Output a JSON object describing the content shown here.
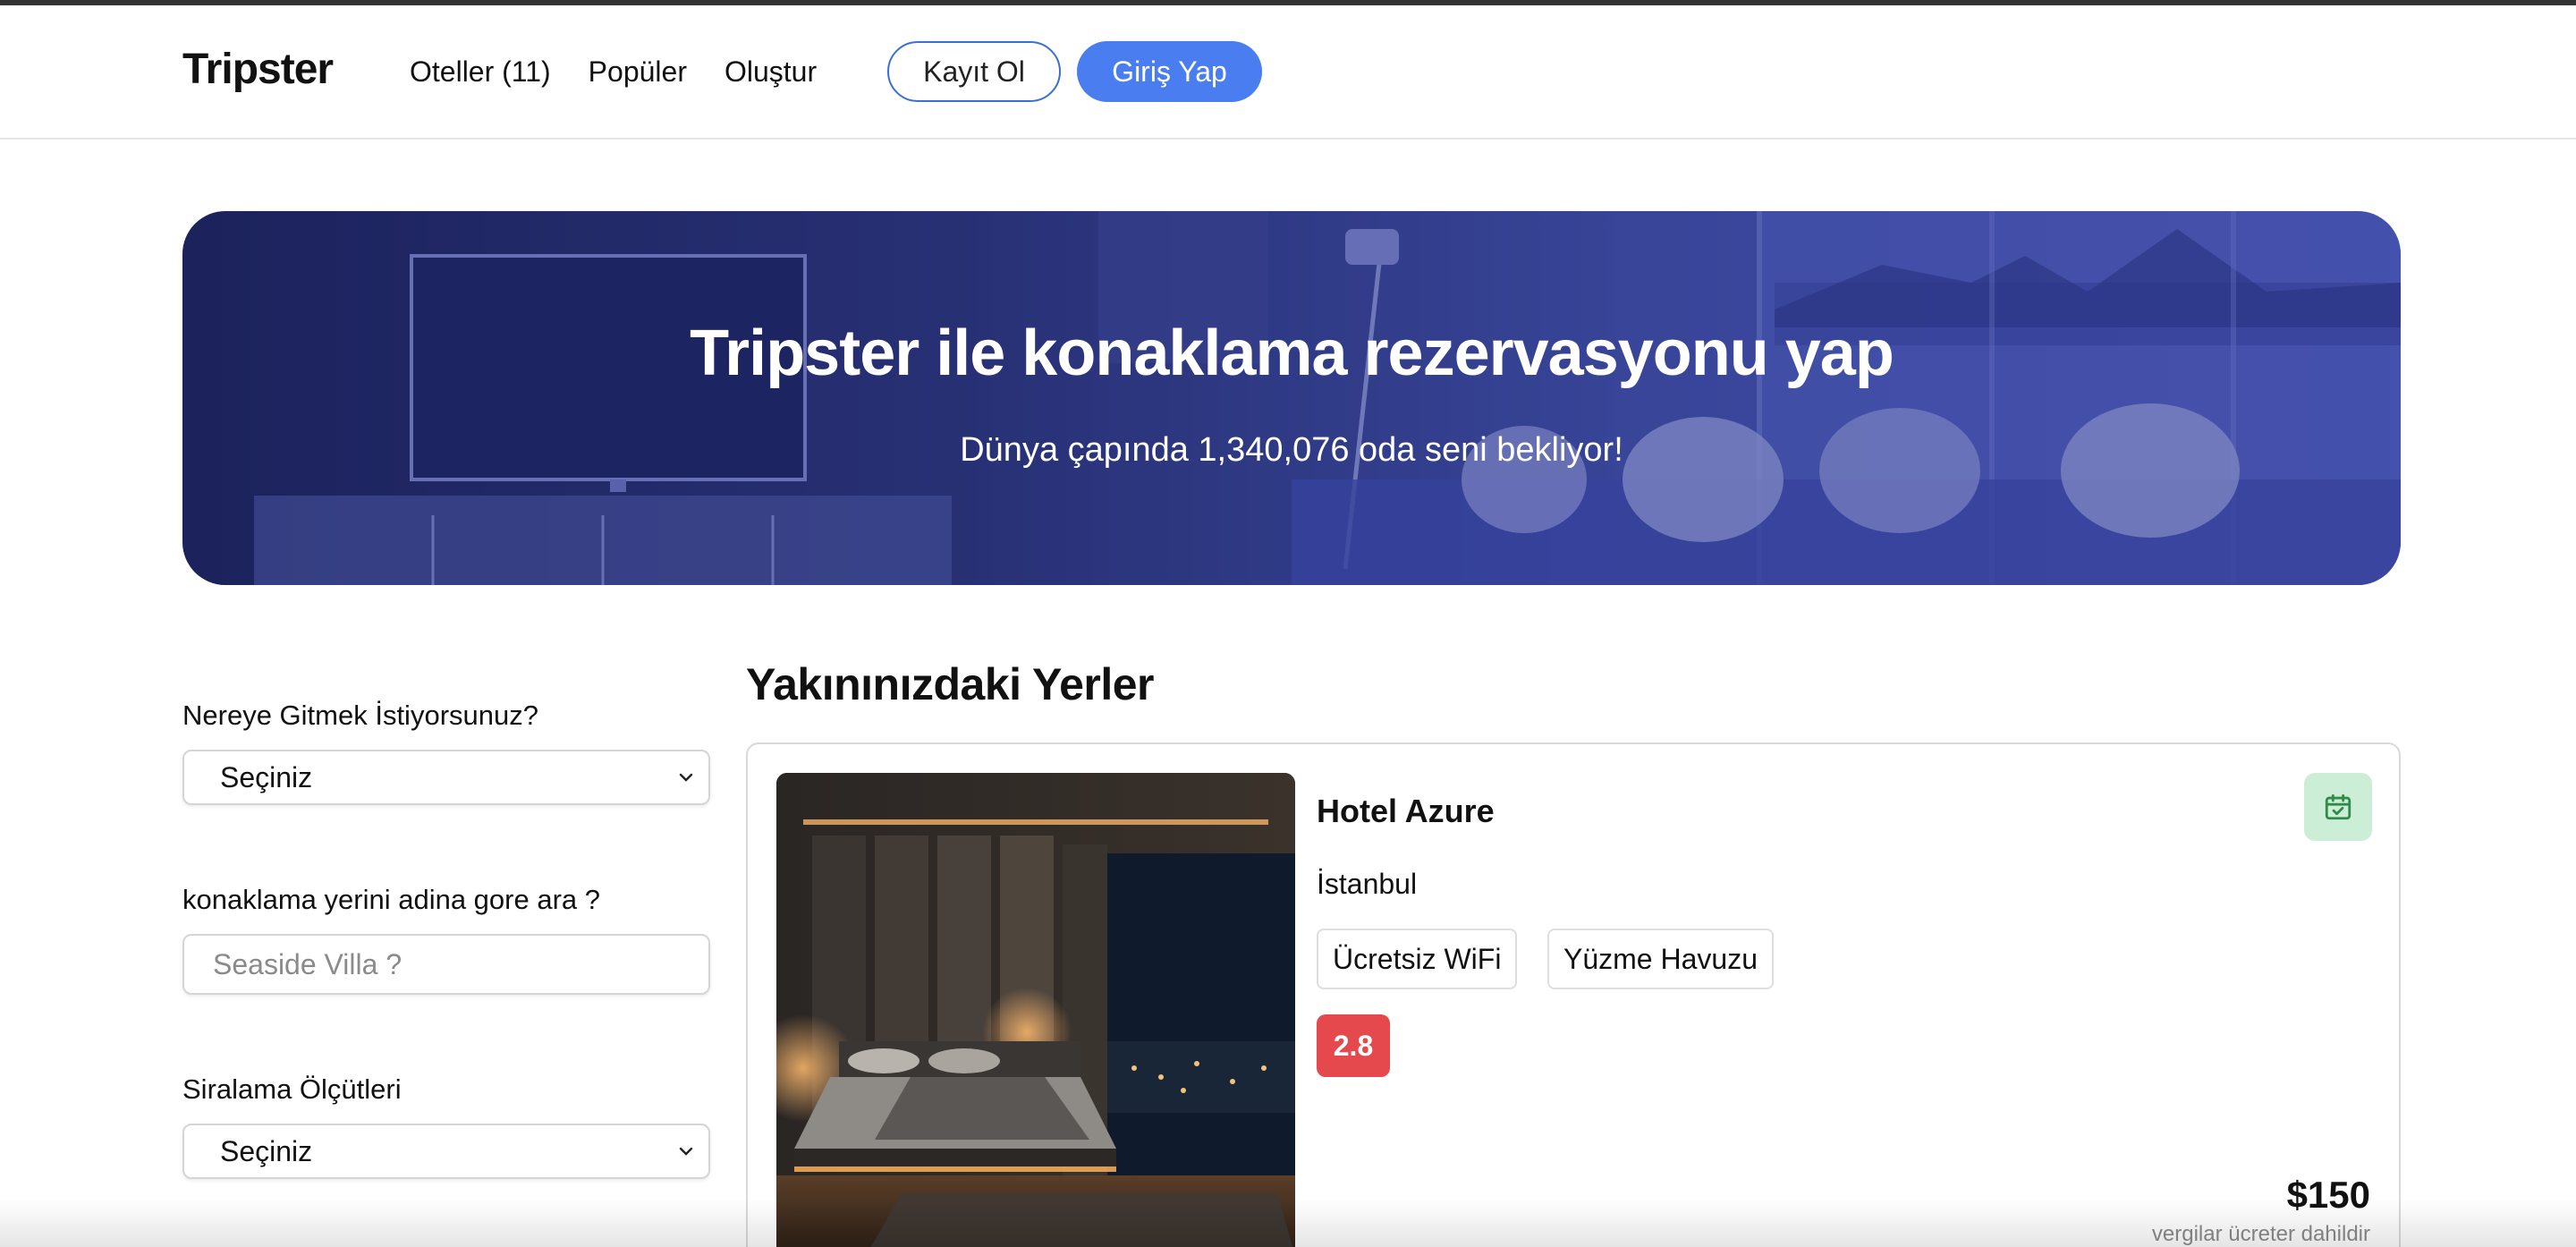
{
  "header": {
    "brand": "Tripster",
    "nav": [
      "Oteller (11)",
      "Popüler",
      "Oluştur"
    ],
    "register_label": "Kayıt Ol",
    "login_label": "Giriş Yap"
  },
  "hero": {
    "title": "Tripster ile konaklama rezervasyonu yap",
    "subtitle": "Dünya çapında 1,340,076 oda seni bekliyor!"
  },
  "filters": {
    "destination_label": "Nereye Gitmek İstiyorsunuz?",
    "destination_value": "Seçiniz",
    "search_label": "konaklama yerini adina gore ara ?",
    "search_placeholder": "Seaside Villa ?",
    "sort_label": "Siralama Ölçütleri",
    "sort_value": "Seçiniz"
  },
  "results": {
    "title": "Yakınınızdaki Yerler",
    "hotels": [
      {
        "name": "Hotel Azure",
        "city": "İstanbul",
        "amenities": [
          "Ücretsiz WiFi",
          "Yüzme Havuzu"
        ],
        "rating": "2.8",
        "price": "$150",
        "price_note": "vergilar ücreter dahildir"
      }
    ]
  },
  "colors": {
    "primary": "#4a7ef0",
    "rating_badge": "#e5484d",
    "calendar_button_bg": "#cdeed6",
    "calendar_icon": "#2e8b4a",
    "hero_tint": "#3a46a0"
  },
  "icons": {
    "select_arrow": "chevron-down-icon",
    "calendar": "calendar-check-icon"
  }
}
